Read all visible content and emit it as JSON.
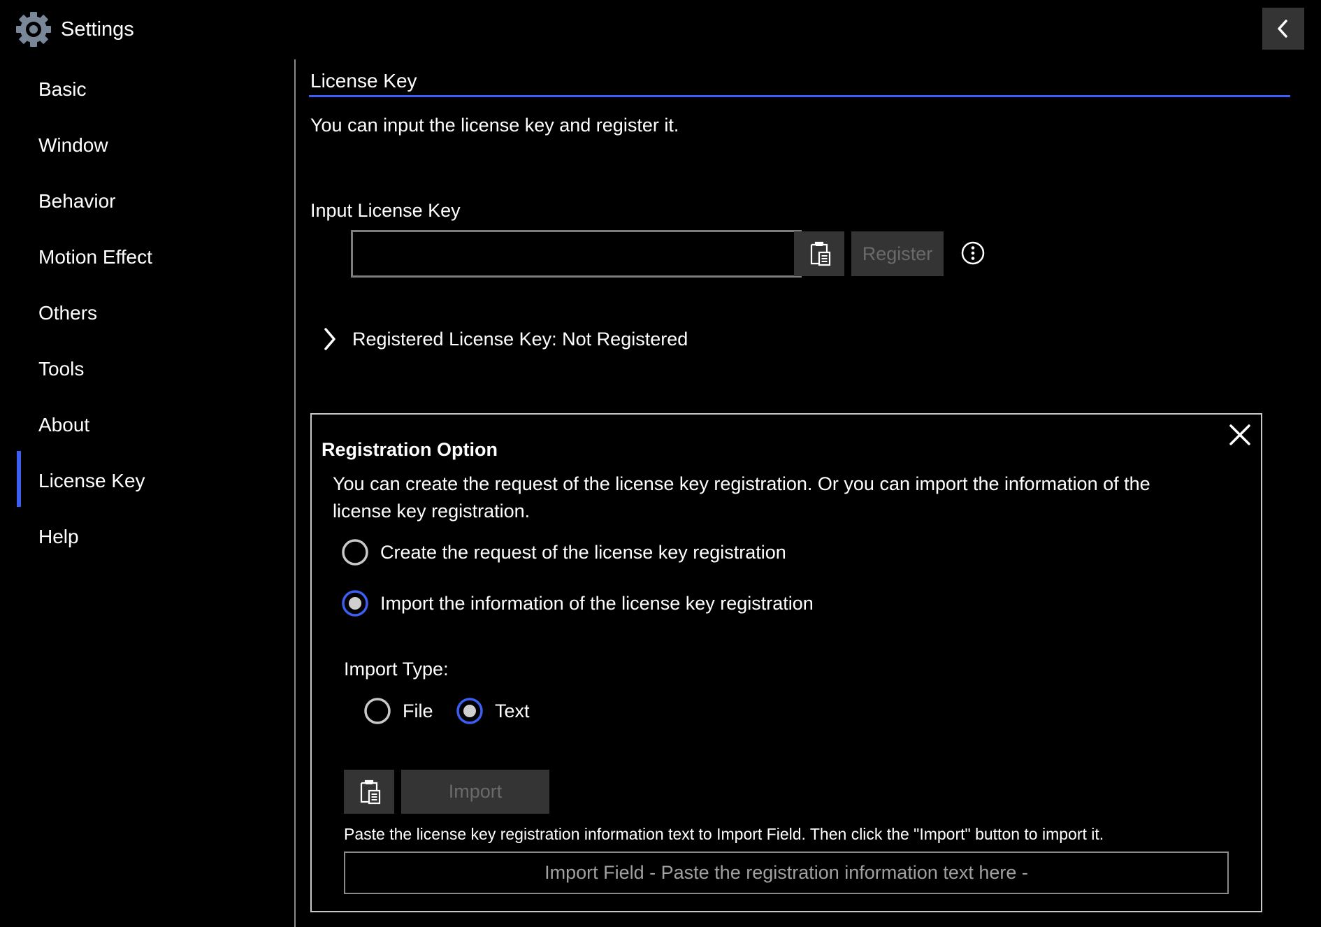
{
  "app": {
    "title": "Settings",
    "icon": "gear-icon",
    "back_icon": "chevron-left-icon"
  },
  "sidebar": {
    "active_index": 7,
    "items": [
      {
        "label": "Basic"
      },
      {
        "label": "Window"
      },
      {
        "label": "Behavior"
      },
      {
        "label": "Motion Effect"
      },
      {
        "label": "Others"
      },
      {
        "label": "Tools"
      },
      {
        "label": "About"
      },
      {
        "label": "License Key"
      },
      {
        "label": "Help"
      }
    ]
  },
  "main": {
    "title": "License Key",
    "description": "You can input the license key and register it.",
    "input_label": "Input License Key",
    "input_value": "",
    "input_placeholder": "",
    "paste_icon": "clipboard-paste-icon",
    "register_label": "Register",
    "register_enabled": false,
    "more_icon": "more-vertical-circle-icon",
    "registered_key": {
      "label": "Registered License Key: Not Registered",
      "expanded": false
    }
  },
  "registration_panel": {
    "title": "Registration Option",
    "close_icon": "close-icon",
    "description": "You can create the request of the license key registration. Or you can import the information of the license key registration.",
    "options": [
      {
        "label": "Create the request of the license key registration",
        "selected": false
      },
      {
        "label": "Import the information of the license key registration",
        "selected": true
      }
    ],
    "import_type": {
      "label": "Import Type:",
      "options": [
        {
          "label": "File",
          "selected": false
        },
        {
          "label": "Text",
          "selected": true
        }
      ]
    },
    "import_label": "Import",
    "import_enabled": false,
    "helper_text": "Paste the license key registration information text to Import Field. Then click the \"Import\" button to import it.",
    "import_field_placeholder": "Import Field - Paste the registration information text here -"
  },
  "colors": {
    "accent": "#3d5ef2",
    "background": "#000000",
    "button_bg": "#343434",
    "disabled_text": "#6a6a6a",
    "gear": "#7a8799"
  }
}
